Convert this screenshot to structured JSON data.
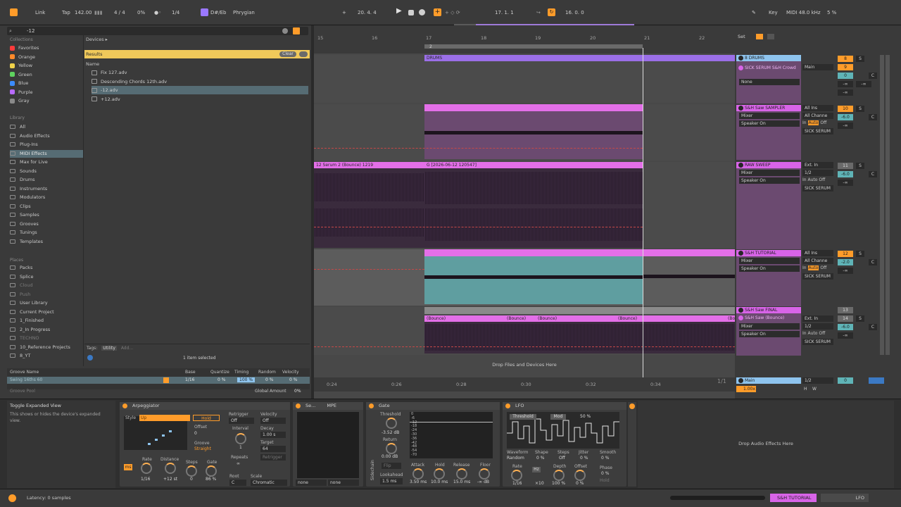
{
  "transport": {
    "link": "Link",
    "tap": "Tap",
    "tempo": "142.00",
    "signature": "4 / 4",
    "cpu_pct": "0%",
    "quantize": "1/4",
    "key": "D#/Eb",
    "scale": "Phrygian",
    "position": "20.  4.  4",
    "loop_start": "17.  1.  1",
    "loop_length": "16.  0.  0",
    "key_btn": "Key",
    "midi_rate": "MIDI  48.0 kHz",
    "cpu_load": "5 %"
  },
  "browser": {
    "search_value": "-12",
    "collections_header": "Collections",
    "collections": [
      {
        "label": "Favorites",
        "color": "#ff3b3b"
      },
      {
        "label": "Orange",
        "color": "#ff8a2a"
      },
      {
        "label": "Yellow",
        "color": "#f0d24a"
      },
      {
        "label": "Green",
        "color": "#5fd35f"
      },
      {
        "label": "Blue",
        "color": "#3b8cff"
      },
      {
        "label": "Purple",
        "color": "#b86bff"
      },
      {
        "label": "Gray",
        "color": "#8a8a8a"
      }
    ],
    "library_header": "Library",
    "library": [
      "All",
      "Audio Effects",
      "Plug-Ins",
      "MIDI Effects",
      "Max for Live",
      "Sounds",
      "Drums",
      "Instruments",
      "Modulators",
      "Clips",
      "Samples",
      "Grooves",
      "Tunings",
      "Templates"
    ],
    "places_header": "Places",
    "places": [
      "Packs",
      "Splice",
      "Cloud",
      "Push",
      "User Library",
      "Current Project",
      "1_Finished",
      "2_In Progress",
      "TECHNO",
      "10_Reference Projects",
      "8_YT"
    ],
    "devices_label": "Devices ▸",
    "results_label": "Results",
    "clear_label": "Clear",
    "name_header": "Name",
    "files": [
      "Fix 127.adv",
      "Descending Chords 12th.adv",
      "-12.adv",
      "+12.adv"
    ],
    "tags_label": "Tags:",
    "tag_utility": "Utility",
    "tag_add": "Add...",
    "selection_count": "1 item selected"
  },
  "groove": {
    "header_name": "Groove Name",
    "header_base": "Base",
    "header_quantize": "Quantize",
    "header_timing": "Timing",
    "header_random": "Random",
    "header_velocity": "Velocity",
    "row_name": "Swing 16ths 60",
    "row_base": "1/16",
    "row_quantize": "0 %",
    "row_timing": "100 %",
    "row_random": "0 %",
    "row_velocity": "0 %",
    "groove_pool": "Groove Pool",
    "global_amount_label": "Global Amount",
    "global_amount": "0%"
  },
  "arrangement": {
    "bars": [
      "15",
      "16",
      "17",
      "18",
      "19",
      "20",
      "21",
      "22"
    ],
    "times": [
      "0:24",
      "0:26",
      "0:28",
      "0:30",
      "0:32",
      "0:34"
    ],
    "loop_marker": "2",
    "drop_hint": "Drop Files and Devices Here",
    "page_counter": "1/1",
    "clips": {
      "drums": "DRUMS",
      "serum_bounce": "12 Serum 2 (Bounce) 1219",
      "g_clip": "G [2026-06-12 120547]",
      "bounce_1": "(Bounce)",
      "bounce_2": "(Bounce)",
      "bounce_3": "(Bounce)",
      "bounce_4": "(Bounce)",
      "bounce_5": "(Bo"
    }
  },
  "mixer": {
    "set_label": "Set",
    "tracks": [
      {
        "name": "8 DRUMS",
        "color": "#8ec4ee"
      },
      {
        "name": "SICK SERUM S&H Crowd",
        "color": "#d864e8"
      },
      {
        "name": "S&H Saw SAMPLER",
        "color": "#d864e8"
      },
      {
        "name": "RAW SWEEP",
        "color": "#d864e8"
      },
      {
        "name": "S&H TUTORIAL",
        "color": "#d864e8"
      },
      {
        "name": "S&H Saw FINAL",
        "color": "#d864e8"
      },
      {
        "name": "S&H Saw (Bounce)",
        "color": "#d864e8"
      }
    ],
    "none": "None",
    "mixer_label": "Mixer",
    "speaker_on": "Speaker On",
    "main_label": "Main",
    "all_ins": "All Ins",
    "all_channels": "All Channe",
    "ext_in": "Ext. In",
    "half": "1/2",
    "in_label": "In",
    "auto_label": "Auto",
    "off_label": "Off",
    "sick_serum": "SICK SERUM",
    "track_numbers": [
      "8",
      "9",
      "10",
      "11",
      "12",
      "13",
      "14"
    ],
    "volumes": [
      "0",
      "-6.0",
      "-6.0",
      "-2.0",
      "-6.0"
    ],
    "inf": "-∞",
    "s_label": "S",
    "c_label": "C",
    "main_footer": "Main",
    "main_vol": "1.00x",
    "h_label": "H",
    "w_label": "W",
    "main_half": "1/2",
    "main_zero": "0"
  },
  "info": {
    "title": "Toggle Expanded View",
    "text": "This shows or hides the device's expanded view."
  },
  "arpeggiator": {
    "title": "Arpeggiator",
    "style_label": "Style",
    "style_value": "Up",
    "hold": "Hold",
    "offset_label": "Offset",
    "offset_value": "0",
    "groove_label": "Groove",
    "groove_value": "Straight",
    "retrigger_label": "Retrigger",
    "retrigger_value": "Off",
    "interval_label": "Interval",
    "interval_value": "1",
    "repeats_label": "Repeats",
    "repeats_value": "∞",
    "velocity_label": "Velocity",
    "velocity_value": "Off",
    "decay_label": "Decay",
    "decay_value": "1.00 s",
    "target_label": "Target",
    "target_value": "64",
    "retrigger_btn": "Retrigger",
    "rate_label": "Rate",
    "rate_value": "1/16",
    "distance_label": "Distance",
    "distance_value": "+12 st",
    "steps_label": "Steps",
    "steps_value": "0",
    "gate_label": "Gate",
    "gate_value": "86 %",
    "root_label": "Root",
    "root_value": "C",
    "scale_label": "Scale",
    "scale_value": "Chromatic",
    "ms_label": "ms"
  },
  "mpe": {
    "title": "Se...",
    "mpe": "MPE",
    "none1": "none",
    "none2": "none"
  },
  "gate": {
    "title": "Gate",
    "threshold_label": "Threshold",
    "threshold_value": "-3.52 dB",
    "return_label": "Return",
    "return_value": "0.00 dB",
    "flip": "Flip",
    "lookahead_label": "Lookahead",
    "lookahead_value": "1.5 ms",
    "attack_label": "Attack",
    "attack_value": "3.50 ms",
    "hold_label": "Hold",
    "hold_value": "10.0 ms",
    "release_label": "Release",
    "release_value": "15.0 ms",
    "floor_label": "Floor",
    "floor_value": "-∞ dB",
    "sidechain": "Sidechain",
    "scale": [
      "0",
      "-6",
      "-12",
      "-18",
      "-24",
      "-30",
      "-36",
      "-42",
      "-48",
      "-54",
      "-70"
    ]
  },
  "lfo": {
    "title": "LFO",
    "threshold": "Threshold",
    "mod": "Mod",
    "pct": "50 %",
    "waveform_label": "Waveform",
    "waveform_value": "Random",
    "shape_label": "Shape",
    "shape_value": "0 %",
    "steps_label": "Steps",
    "steps_value": "Off",
    "jitter_label": "Jitter",
    "jitter_value": "0 %",
    "smooth_label": "Smooth",
    "smooth_value": "0 %",
    "rate_label": "Rate",
    "rate_value": "1/16",
    "hz_label": "Hz",
    "mult_value": "×10",
    "depth_label": "Depth",
    "depth_value": "100 %",
    "offset_label": "Offset",
    "offset_value": "0 %",
    "phase_label": "Phase",
    "phase_value": "0 %",
    "hold_label": "Hold"
  },
  "audio_drop": "Drop Audio Effects Here",
  "status": {
    "latency": "Latency: 0 samples",
    "track_name": "S&H TUTORIAL",
    "device_name": "LFO"
  }
}
